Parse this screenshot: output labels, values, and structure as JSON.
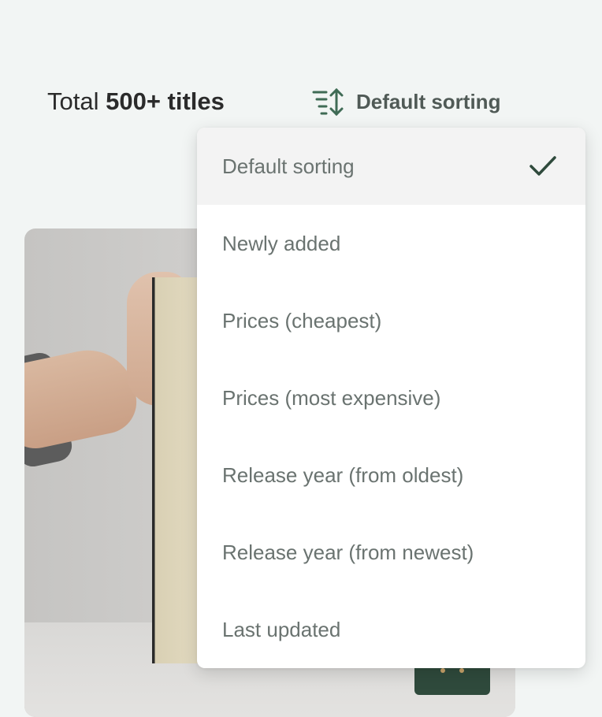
{
  "header": {
    "total_prefix": "Total",
    "total_count": "500+ titles",
    "sort_label": "Default sorting",
    "sort_icon": "sort-order-icon"
  },
  "sort_menu": {
    "selected_index": 0,
    "options": [
      {
        "label": "Default sorting",
        "selected": true
      },
      {
        "label": "Newly added",
        "selected": false
      },
      {
        "label": "Prices (cheapest)",
        "selected": false
      },
      {
        "label": "Prices (most expensive)",
        "selected": false
      },
      {
        "label": "Release year (from oldest)",
        "selected": false
      },
      {
        "label": "Release year (from newest)",
        "selected": false
      },
      {
        "label": "Last updated",
        "selected": false
      }
    ],
    "check_icon": "checkmark-icon"
  },
  "colors": {
    "page_background": "#f2f5f4",
    "accent_green": "#3f6b55",
    "cart_button": "#2f4a3c",
    "menu_selected_bg": "#f3f3f3",
    "menu_text": "#6a7370"
  }
}
